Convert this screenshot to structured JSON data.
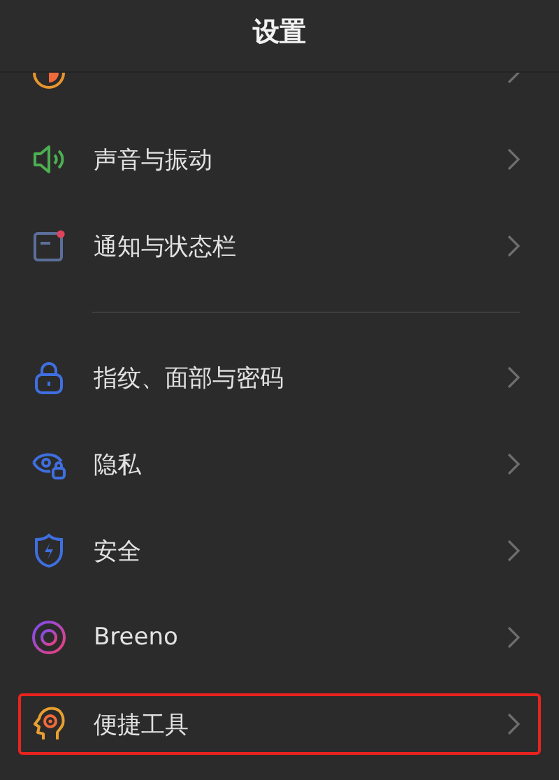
{
  "header": {
    "title": "设置"
  },
  "sections": [
    {
      "items": [
        {
          "highlighted": false
        },
        {
          "label": "声音与振动",
          "highlighted": false
        },
        {
          "label": "通知与状态栏",
          "highlighted": false
        }
      ]
    },
    {
      "items": [
        {
          "label": "指纹、面部与密码",
          "highlighted": false
        },
        {
          "label": "隐私",
          "highlighted": false
        },
        {
          "label": "安全",
          "highlighted": false
        },
        {
          "label": "Breeno",
          "highlighted": false
        },
        {
          "label": "便捷工具",
          "highlighted": true
        }
      ]
    }
  ]
}
